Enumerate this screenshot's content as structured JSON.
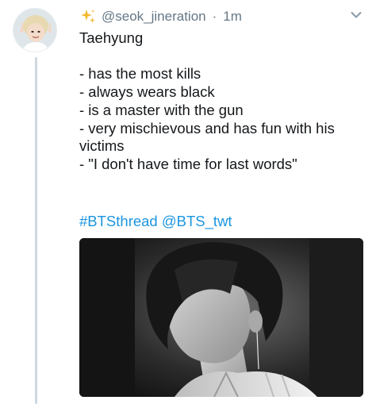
{
  "tweet": {
    "handle": "@seok_jineration",
    "separator": "·",
    "time": "1m",
    "lines": [
      "Taehyung",
      "",
      "- has the most kills",
      "- always wears black",
      "- is a master with the gun",
      "- very mischievous and has fun with his",
      "victims",
      "- \"I don't have time for last words\""
    ],
    "hashtag": "#BTSthread",
    "mention": "@BTS_twt"
  },
  "icons": {
    "badge": "sparkle-badge-icon",
    "menu": "chevron-down-icon"
  },
  "colors": {
    "link": "#1b95e0",
    "meta": "#657786",
    "text": "#14171a",
    "badge": "#f5b82e"
  }
}
